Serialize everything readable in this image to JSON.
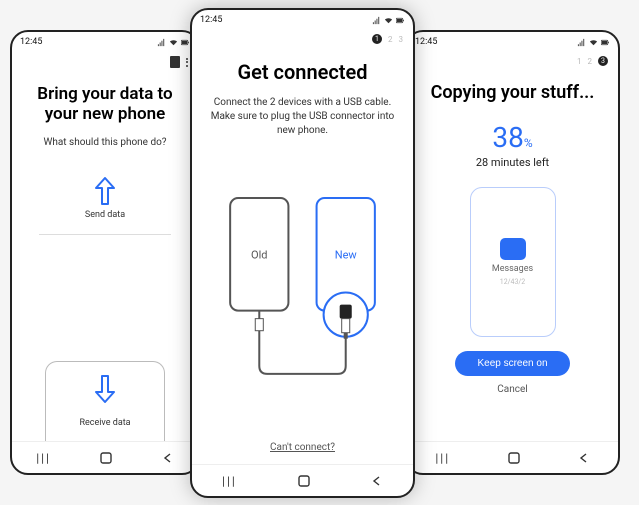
{
  "status": {
    "time": "12:45"
  },
  "left": {
    "title_line1": "Bring your data to",
    "title_line2": "your new phone",
    "subtitle": "What should this phone do?",
    "send_label": "Send data",
    "receive_label": "Receive data"
  },
  "center": {
    "steps": {
      "current": "1",
      "s2": "2",
      "s3": "3"
    },
    "title": "Get connected",
    "desc": "Connect the 2 devices with a USB cable. Make sure to plug the USB connector into new phone.",
    "old_label": "Old",
    "new_label": "New",
    "link": "Can't connect?"
  },
  "right": {
    "steps": {
      "s1": "1",
      "s2": "2",
      "current": "3"
    },
    "title": "Copying your stuff...",
    "percent_value": "38",
    "percent_sym": "%",
    "minutes_left": "28 minutes left",
    "item_label": "Messages",
    "item_sub": "12/43/2",
    "keep_screen": "Keep screen on",
    "cancel": "Cancel"
  },
  "nav": {
    "recents": "|||"
  }
}
